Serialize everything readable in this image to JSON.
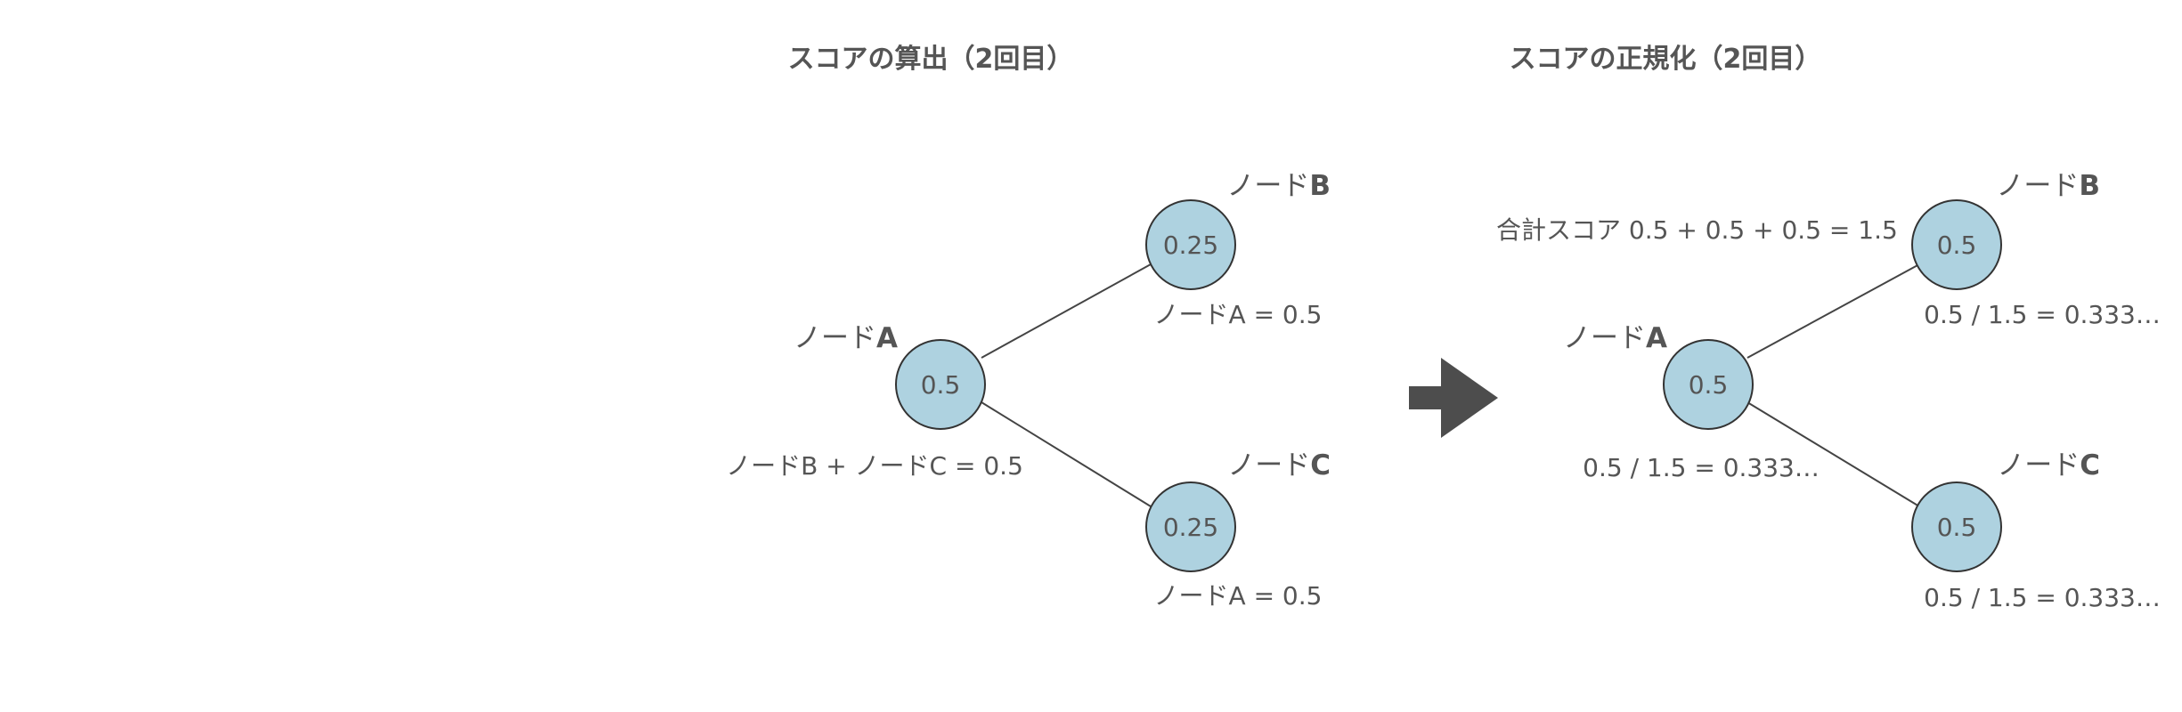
{
  "colors": {
    "node_fill": "#aed2e0",
    "node_stroke": "#333333",
    "text": "#555555",
    "arrow": "#4d4d4d"
  },
  "left": {
    "title": "スコアの算出（2回目）",
    "nodeA": {
      "label_prefix": "ノード",
      "label_letter": "A",
      "value": "0.5",
      "formula": "ノードB + ノードC = 0.5"
    },
    "nodeB": {
      "label_prefix": "ノード",
      "label_letter": "B",
      "value": "0.25",
      "formula": "ノードA = 0.5"
    },
    "nodeC": {
      "label_prefix": "ノード",
      "label_letter": "C",
      "value": "0.25",
      "formula": "ノードA = 0.5"
    }
  },
  "arrow_icon": "right-arrow-icon",
  "right": {
    "title": "スコアの正規化（2回目）",
    "total": "合計スコア 0.5 + 0.5 + 0.5 = 1.5",
    "nodeA": {
      "label_prefix": "ノード",
      "label_letter": "A",
      "value": "0.5",
      "formula": "0.5 / 1.5 = 0.333…"
    },
    "nodeB": {
      "label_prefix": "ノード",
      "label_letter": "B",
      "value": "0.5",
      "formula": "0.5 / 1.5 = 0.333…"
    },
    "nodeC": {
      "label_prefix": "ノード",
      "label_letter": "C",
      "value": "0.5",
      "formula": "0.5 / 1.5 = 0.333…"
    }
  }
}
